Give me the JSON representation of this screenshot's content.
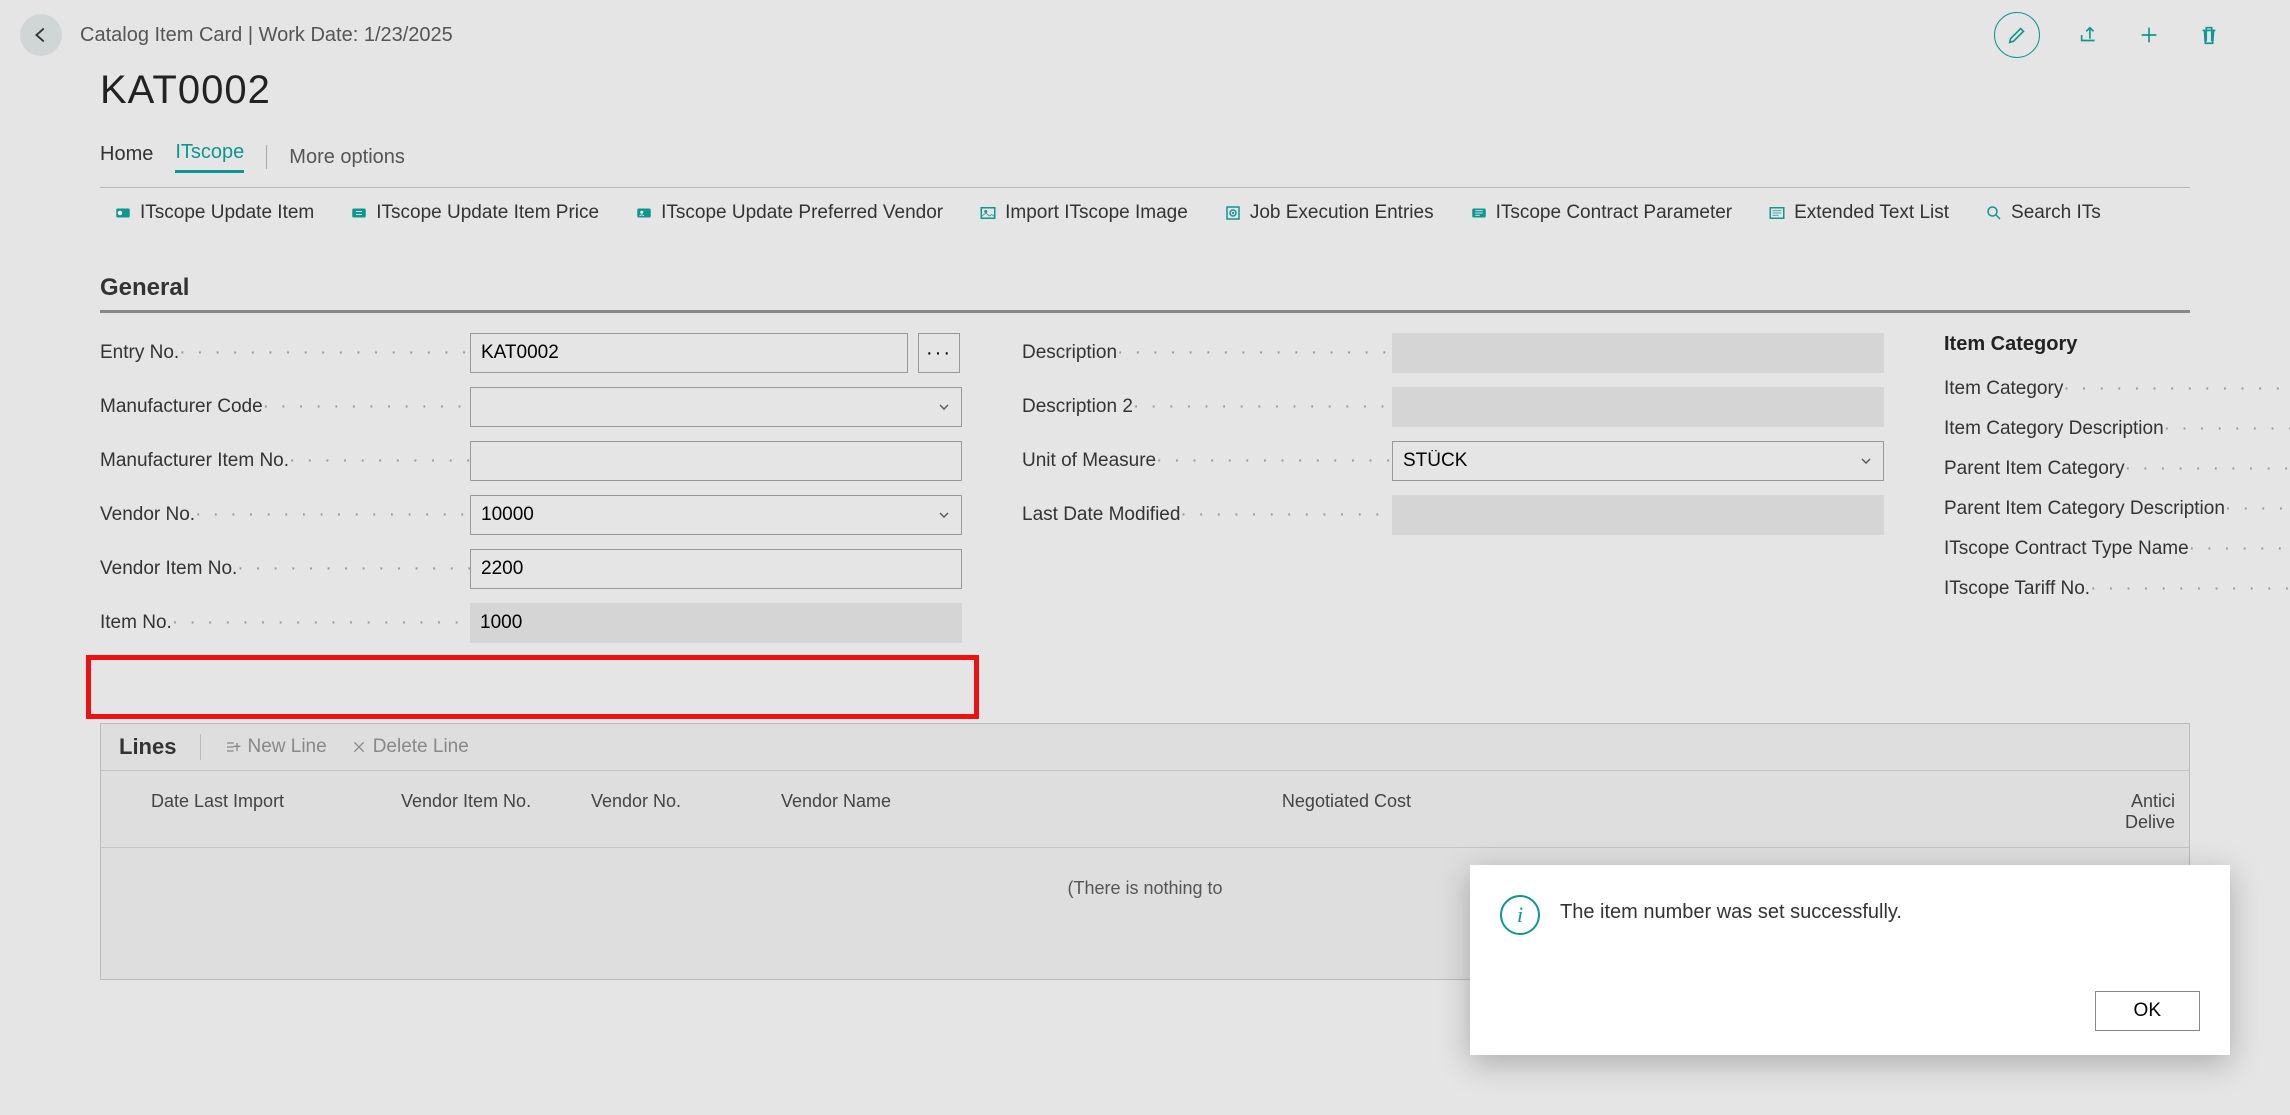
{
  "header": {
    "breadcrumb": "Catalog Item Card | Work Date: 1/23/2025",
    "title": "KAT0002"
  },
  "nav": {
    "home": "Home",
    "itscope": "ITscope",
    "more": "More options"
  },
  "actions": {
    "update_item": "ITscope Update Item",
    "update_price": "ITscope Update Item Price",
    "update_vendor": "ITscope Update Preferred Vendor",
    "import_image": "Import ITscope Image",
    "job_entries": "Job Execution Entries",
    "contract_param": "ITscope Contract Parameter",
    "ext_text": "Extended Text List",
    "search": "Search ITs"
  },
  "section": {
    "general": "General"
  },
  "labels": {
    "entry_no": "Entry No.",
    "manufacturer_code": "Manufacturer Code",
    "manufacturer_item_no": "Manufacturer Item No.",
    "vendor_no": "Vendor No.",
    "vendor_item_no": "Vendor Item No.",
    "item_no": "Item No.",
    "description": "Description",
    "description2": "Description 2",
    "unit_of_measure": "Unit of Measure",
    "last_modified": "Last Date Modified"
  },
  "values": {
    "entry_no": "KAT0002",
    "manufacturer_code": "",
    "manufacturer_item_no": "",
    "vendor_no": "10000",
    "vendor_item_no": "2200",
    "item_no": "1000",
    "description": "",
    "description2": "",
    "unit_of_measure": "STÜCK",
    "last_modified": ""
  },
  "sidecol": {
    "title": "Item Category",
    "rows": {
      "cat": "Item Category",
      "cat_desc": "Item Category Description",
      "parent_cat": "Parent Item Category",
      "parent_cat_desc": "Parent Item Category Description",
      "contract_type": "ITscope Contract Type Name",
      "tariff": "ITscope Tariff No."
    }
  },
  "lines": {
    "title": "Lines",
    "new_line": "New Line",
    "delete_line": "Delete Line",
    "cols": {
      "date_last_import": "Date Last Import",
      "vendor_item_no": "Vendor Item No.",
      "vendor_no": "Vendor No.",
      "vendor_name": "Vendor Name",
      "neg_cost": "Negotiated Cost",
      "antic_deliv": "Antici\nDelive"
    },
    "empty": "(There is nothing to"
  },
  "dialog": {
    "message": "The item number was set successfully.",
    "ok": "OK"
  }
}
